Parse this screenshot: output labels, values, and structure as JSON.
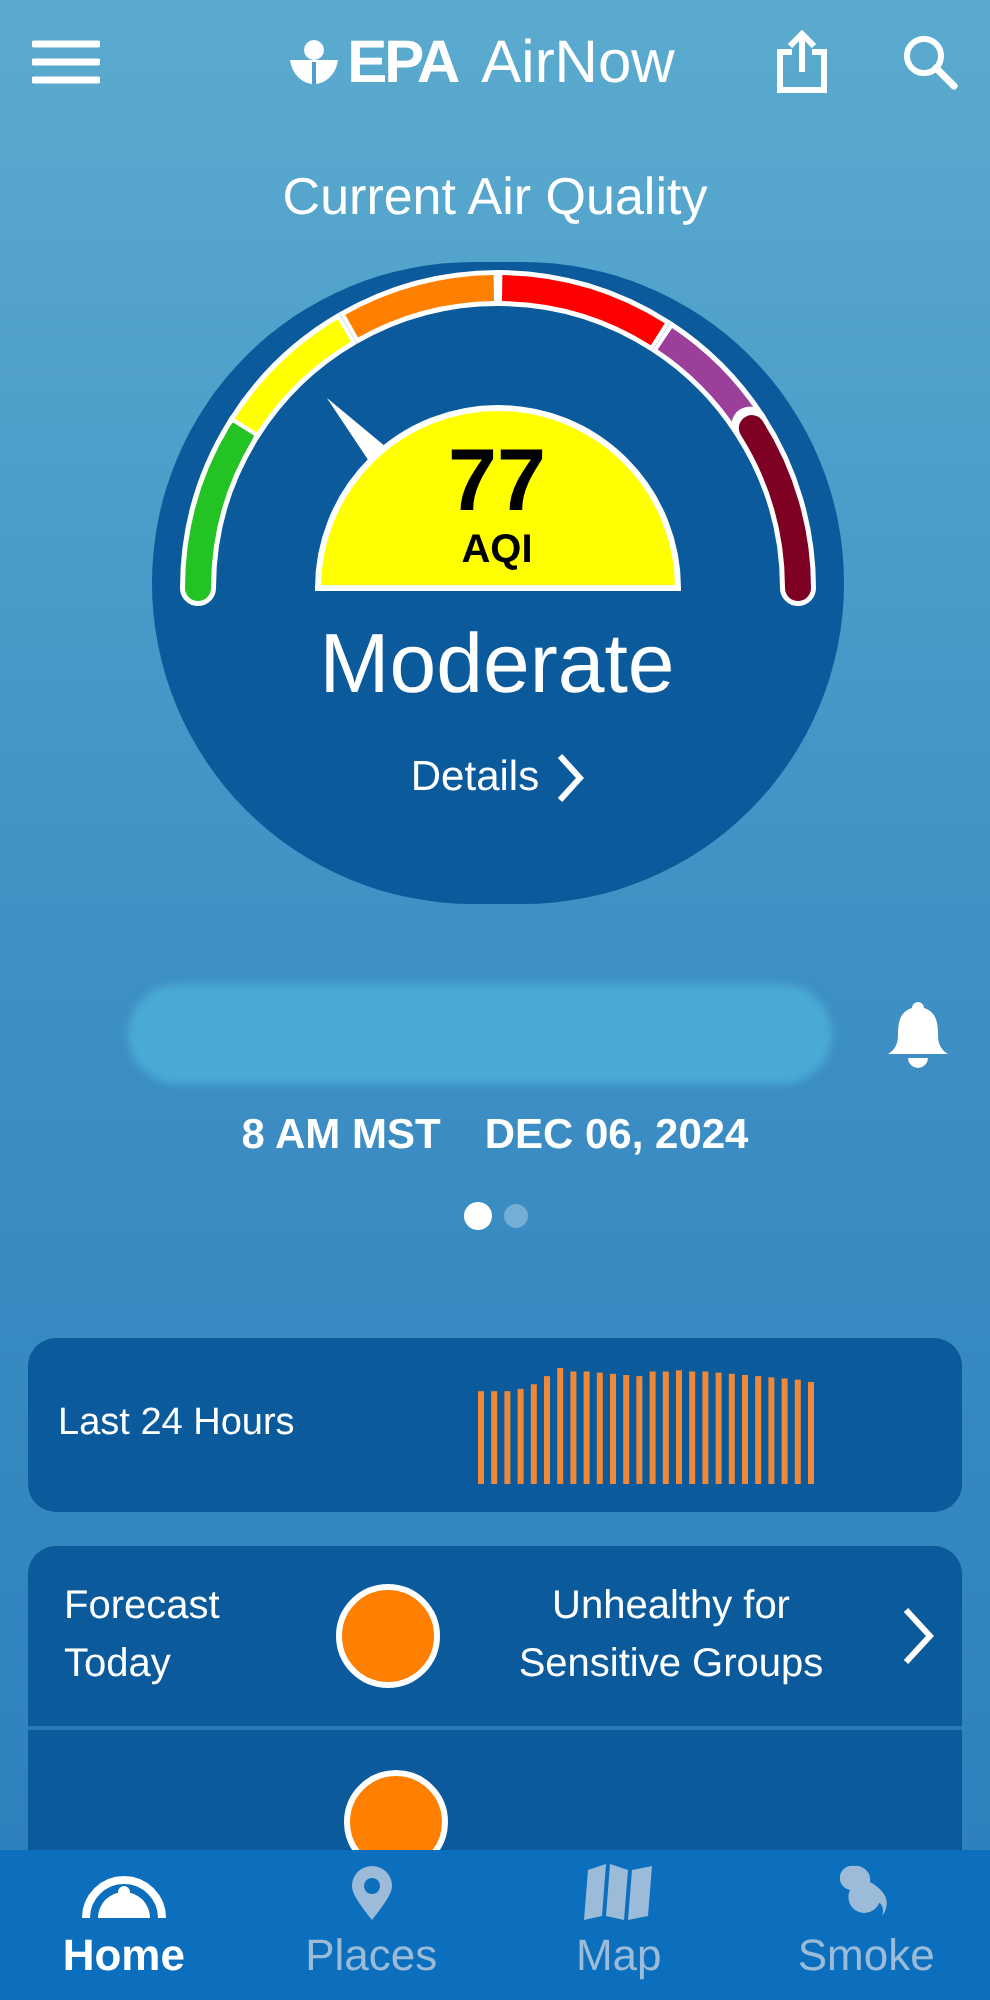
{
  "header": {
    "logo_text": "EPA",
    "title": "AirNow"
  },
  "page_title": "Current Air Quality",
  "gauge": {
    "aqi": "77",
    "unit": "AQI",
    "category": "Moderate",
    "details_link": "Details"
  },
  "reading": {
    "time": "8 AM MST",
    "date": "DEC 06, 2024"
  },
  "pager": [
    {
      "selected": true
    },
    {
      "selected": false
    }
  ],
  "history_card": {
    "label": "Last 24 Hours"
  },
  "forecast": [
    {
      "label": "Forecast Today",
      "category": "Unhealthy for Sensitive Groups",
      "color": "#ff8000"
    }
  ],
  "nav": [
    {
      "label": "Home",
      "kind": "home",
      "selected": true
    },
    {
      "label": "Places",
      "kind": "places",
      "selected": false
    },
    {
      "label": "Map",
      "kind": "map",
      "selected": false
    },
    {
      "label": "Smoke",
      "kind": "smoke",
      "selected": false
    }
  ]
}
